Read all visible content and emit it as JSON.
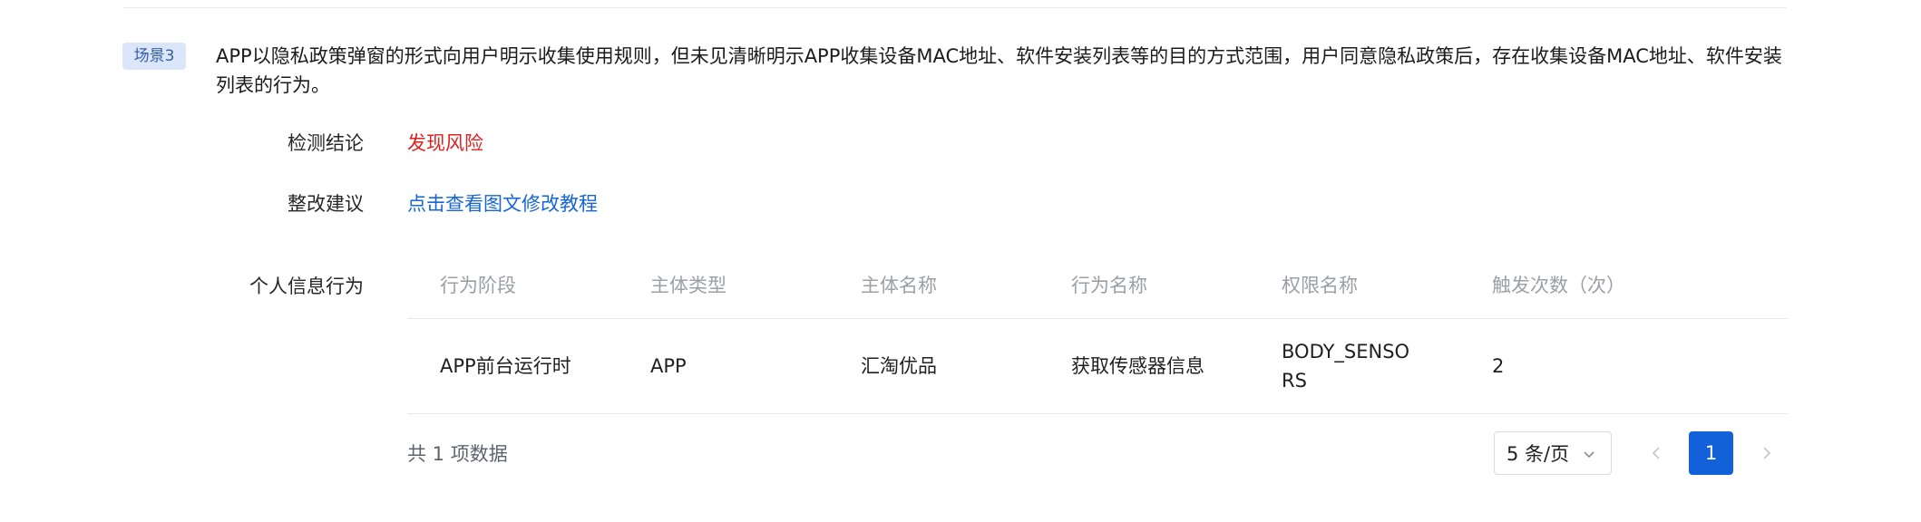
{
  "scene": {
    "tag": "场景3",
    "description": "APP以隐私政策弹窗的形式向用户明示收集使用规则，但未见清晰明示APP收集设备MAC地址、软件安装列表等的目的方式范围，用户同意隐私政策后，存在收集设备MAC地址、软件安装列表的行为。"
  },
  "detection": {
    "label": "检测结论",
    "value": "发现风险",
    "value_color": "#e02020"
  },
  "suggestion": {
    "label": "整改建议",
    "link_text": "点击查看图文修改教程",
    "link_color": "#1766d6"
  },
  "behavior": {
    "label": "个人信息行为",
    "columns": [
      "行为阶段",
      "主体类型",
      "主体名称",
      "行为名称",
      "权限名称",
      "触发次数（次）"
    ],
    "rows": [
      [
        "APP前台运行时",
        "APP",
        "汇淘优品",
        "获取传感器信息",
        "BODY_SENSORS",
        "2"
      ]
    ]
  },
  "pagination": {
    "total_text": "共 1 项数据",
    "page_size": "5 条/页",
    "current_page": "1",
    "accent_color": "#1361d9",
    "prev_icon": "chevron-left-icon",
    "next_icon": "chevron-right-icon",
    "dropdown_icon": "chevron-down-icon"
  }
}
